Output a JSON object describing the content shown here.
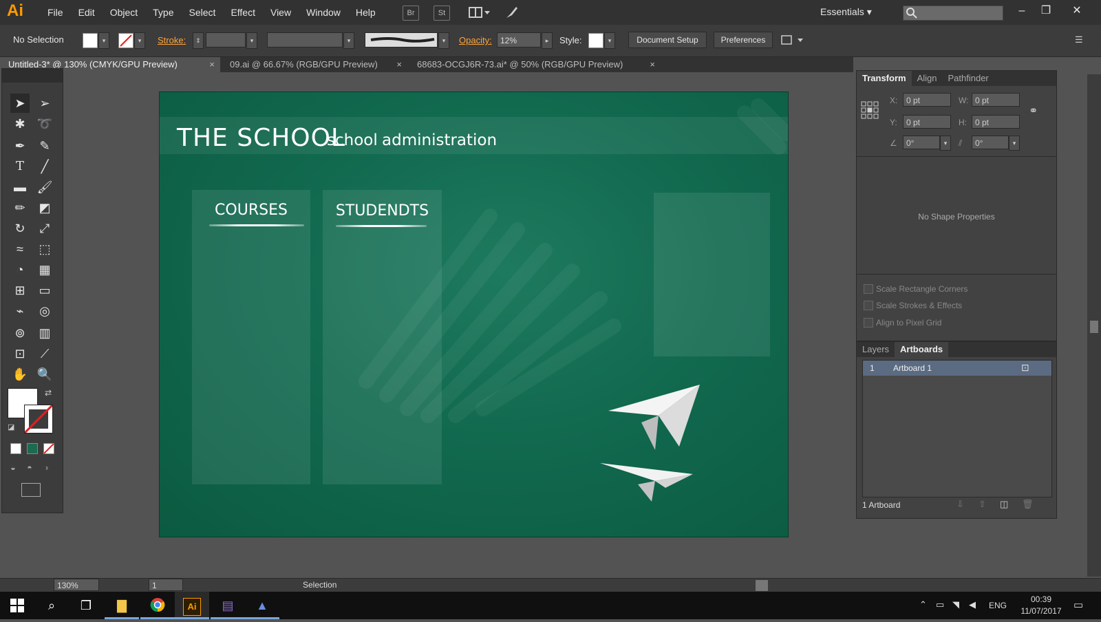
{
  "app": {
    "logo": "Ai",
    "menu": [
      "File",
      "Edit",
      "Object",
      "Type",
      "Select",
      "Effect",
      "View",
      "Window",
      "Help"
    ],
    "bridge_label": "Br",
    "stock_label": "St",
    "workspace": "Essentials"
  },
  "control_bar": {
    "selection": "No Selection",
    "stroke_label": "Stroke:",
    "opacity_label": "Opacity:",
    "opacity_value": "12%",
    "style_label": "Style:",
    "document_setup": "Document Setup",
    "preferences": "Preferences"
  },
  "tabs": [
    {
      "label": "Untitled-3* @ 130% (CMYK/GPU Preview)",
      "close": "×"
    },
    {
      "label": "09.ai @ 66.67% (RGB/GPU Preview)",
      "close": "×"
    },
    {
      "label": "68683-OCGJ6R-73.ai* @ 50% (RGB/GPU Preview)",
      "close": "×"
    }
  ],
  "artboard": {
    "title": "THE SCHOOL",
    "sub1": "school",
    "sub2": "administration",
    "col1": "COURSES",
    "col2": "STUDENDTS"
  },
  "transform_panel": {
    "tabs": [
      "Transform",
      "Align",
      "Pathfinder"
    ],
    "x_label": "X:",
    "x_value": "0 pt",
    "y_label": "Y:",
    "y_value": "0 pt",
    "w_label": "W:",
    "w_value": "0 pt",
    "h_label": "H:",
    "h_value": "0 pt",
    "angle_value": "0°",
    "shear_value": "0°",
    "empty_message": "No Shape Properties",
    "options": [
      "Scale Rectangle Corners",
      "Scale Strokes & Effects",
      "Align to Pixel Grid"
    ]
  },
  "layers_panel": {
    "tabs": [
      "Layers",
      "Artboards"
    ],
    "rows": [
      {
        "index": "1",
        "name": "Artboard 1"
      }
    ],
    "footer": "1 Artboard"
  },
  "status_bar": {
    "zoom": "130%",
    "page": "1",
    "tool": "Selection"
  },
  "taskbar": {
    "lang": "ENG",
    "time": "00:39",
    "date": "11/07/2017",
    "ai_label": "Ai"
  },
  "colors": {
    "accent": "#ff9a00",
    "chalkboard": "#0e6449"
  }
}
